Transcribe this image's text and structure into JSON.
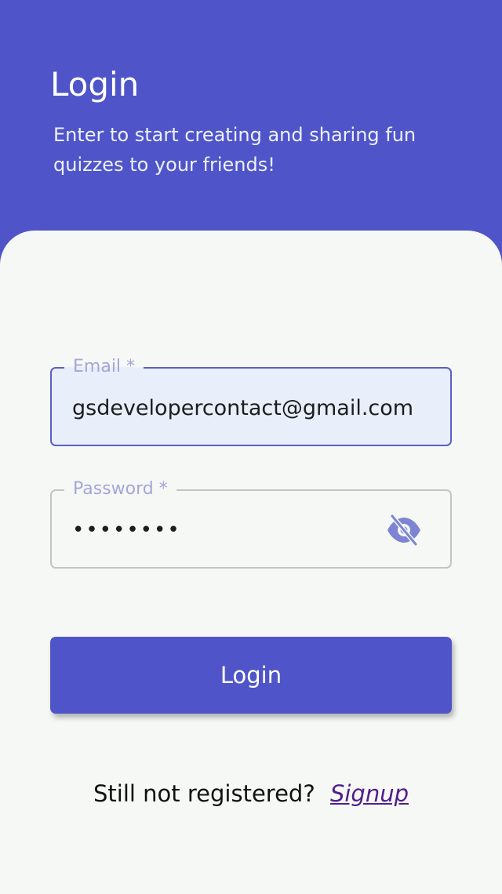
{
  "header": {
    "title": "Login",
    "subtitle": "Enter to start creating and sharing fun quizzes to your friends!"
  },
  "form": {
    "email": {
      "label": "Email *",
      "value": "gsdevelopercontact@gmail.com"
    },
    "password": {
      "label": "Password *",
      "value": "••••••••",
      "toggle_icon": "eye-off-icon"
    },
    "submit_label": "Login"
  },
  "footer": {
    "prompt": "Still not registered?",
    "link": "Signup"
  },
  "colors": {
    "primary": "#4f55c8",
    "background": "#f6f8f6",
    "field_active_bg": "#e8effb",
    "label": "#a4a6d6",
    "icon": "#7d84d1",
    "link": "#4f1f8a"
  }
}
